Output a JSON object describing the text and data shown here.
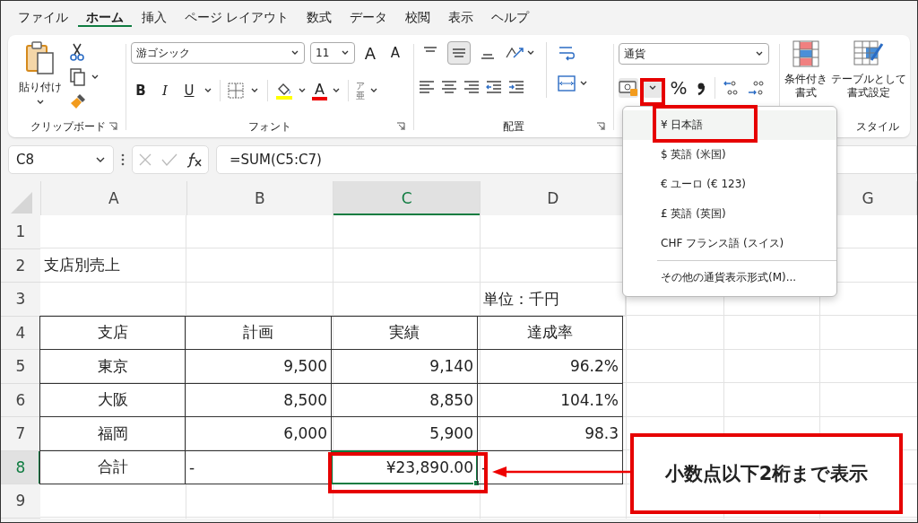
{
  "menu_tabs": [
    {
      "label": "ファイル",
      "selected": false
    },
    {
      "label": "ホーム",
      "selected": true
    },
    {
      "label": "挿入",
      "selected": false
    },
    {
      "label": "ページ レイアウト",
      "selected": false
    },
    {
      "label": "数式",
      "selected": false
    },
    {
      "label": "データ",
      "selected": false
    },
    {
      "label": "校閲",
      "selected": false
    },
    {
      "label": "表示",
      "selected": false
    },
    {
      "label": "ヘルプ",
      "selected": false
    }
  ],
  "ribbon": {
    "clipboard": {
      "paste_label": "貼り付け",
      "group_label": "クリップボード"
    },
    "font": {
      "font_name": "游ゴシック",
      "font_size": "11",
      "grow_label": "A",
      "shrink_label": "A",
      "bold_label": "B",
      "italic_label": "I",
      "underline_label": "U",
      "font_color_label": "A",
      "phonetic_top": "ア",
      "phonetic_bottom": "亜",
      "group_label": "フォント"
    },
    "alignment": {
      "buttons": [
        {
          "kind": "top",
          "selected": false
        },
        {
          "kind": "middle",
          "selected": true
        },
        {
          "kind": "bottom",
          "selected": false
        }
      ],
      "group_label": "配置"
    },
    "number": {
      "format": "通貨",
      "percent_label": "%"
    },
    "styles": {
      "conditional_label": "条件付き",
      "conditional_label_2": "書式",
      "table_label": "テーブルとして",
      "table_label_2": "書式設定",
      "group_label": "スタイル"
    }
  },
  "currency_menu": {
    "items": [
      {
        "label": "¥ 日本語",
        "selected": true
      },
      {
        "label": "$ 英語 (米国)",
        "selected": false
      },
      {
        "label": "€ ユーロ (€ 123)",
        "selected": false
      },
      {
        "label": "£ 英語 (英国)",
        "selected": false
      },
      {
        "label": "CHF フランス語 (スイス)",
        "selected": false
      }
    ],
    "more": "その他の通貨表示形式(M)..."
  },
  "formula_bar": {
    "name_box": "C8",
    "formula": "=SUM(C5:C7)"
  },
  "sheet": {
    "columns": [
      {
        "label": "A",
        "selected": false
      },
      {
        "label": "B",
        "selected": false
      },
      {
        "label": "C",
        "selected": true
      },
      {
        "label": "D",
        "selected": false
      },
      {
        "label": "G",
        "selected": false
      }
    ],
    "rows": [
      {
        "label": "1",
        "selected": false
      },
      {
        "label": "2",
        "selected": false
      },
      {
        "label": "3",
        "selected": false
      },
      {
        "label": "4",
        "selected": false
      },
      {
        "label": "5",
        "selected": false
      },
      {
        "label": "6",
        "selected": false
      },
      {
        "label": "7",
        "selected": false
      },
      {
        "label": "8",
        "selected": true
      },
      {
        "label": "9",
        "selected": false
      }
    ],
    "title": "支店別売上",
    "unit": "単位：千円",
    "table": {
      "header": [
        "支店",
        "計画",
        "実績",
        "達成率"
      ],
      "rows": [
        {
          "cells": [
            {
              "text": "東京",
              "kind": "label",
              "selected": false
            },
            {
              "text": "9,500",
              "kind": "number",
              "selected": false
            },
            {
              "text": "9,140",
              "kind": "number",
              "selected": false
            },
            {
              "text": "96.2%",
              "kind": "number",
              "selected": false
            }
          ]
        },
        {
          "cells": [
            {
              "text": "大阪",
              "kind": "label",
              "selected": false
            },
            {
              "text": "8,500",
              "kind": "number",
              "selected": false
            },
            {
              "text": "8,850",
              "kind": "number",
              "selected": false
            },
            {
              "text": "104.1%",
              "kind": "number",
              "selected": false
            }
          ]
        },
        {
          "cells": [
            {
              "text": "福岡",
              "kind": "label",
              "selected": false
            },
            {
              "text": "6,000",
              "kind": "number",
              "selected": false
            },
            {
              "text": "5,900",
              "kind": "number",
              "selected": false
            },
            {
              "text": "98.3",
              "kind": "number",
              "selected": false
            }
          ]
        },
        {
          "cells": [
            {
              "text": "合計",
              "kind": "label",
              "selected": false
            },
            {
              "text": "-",
              "kind": "dash",
              "selected": false
            },
            {
              "text": "¥23,890.00",
              "kind": "number",
              "selected": true
            },
            {
              "text": "-",
              "kind": "dash",
              "selected": false
            }
          ]
        }
      ]
    }
  },
  "callout": {
    "text": "小数点以下2桁まで表示"
  }
}
